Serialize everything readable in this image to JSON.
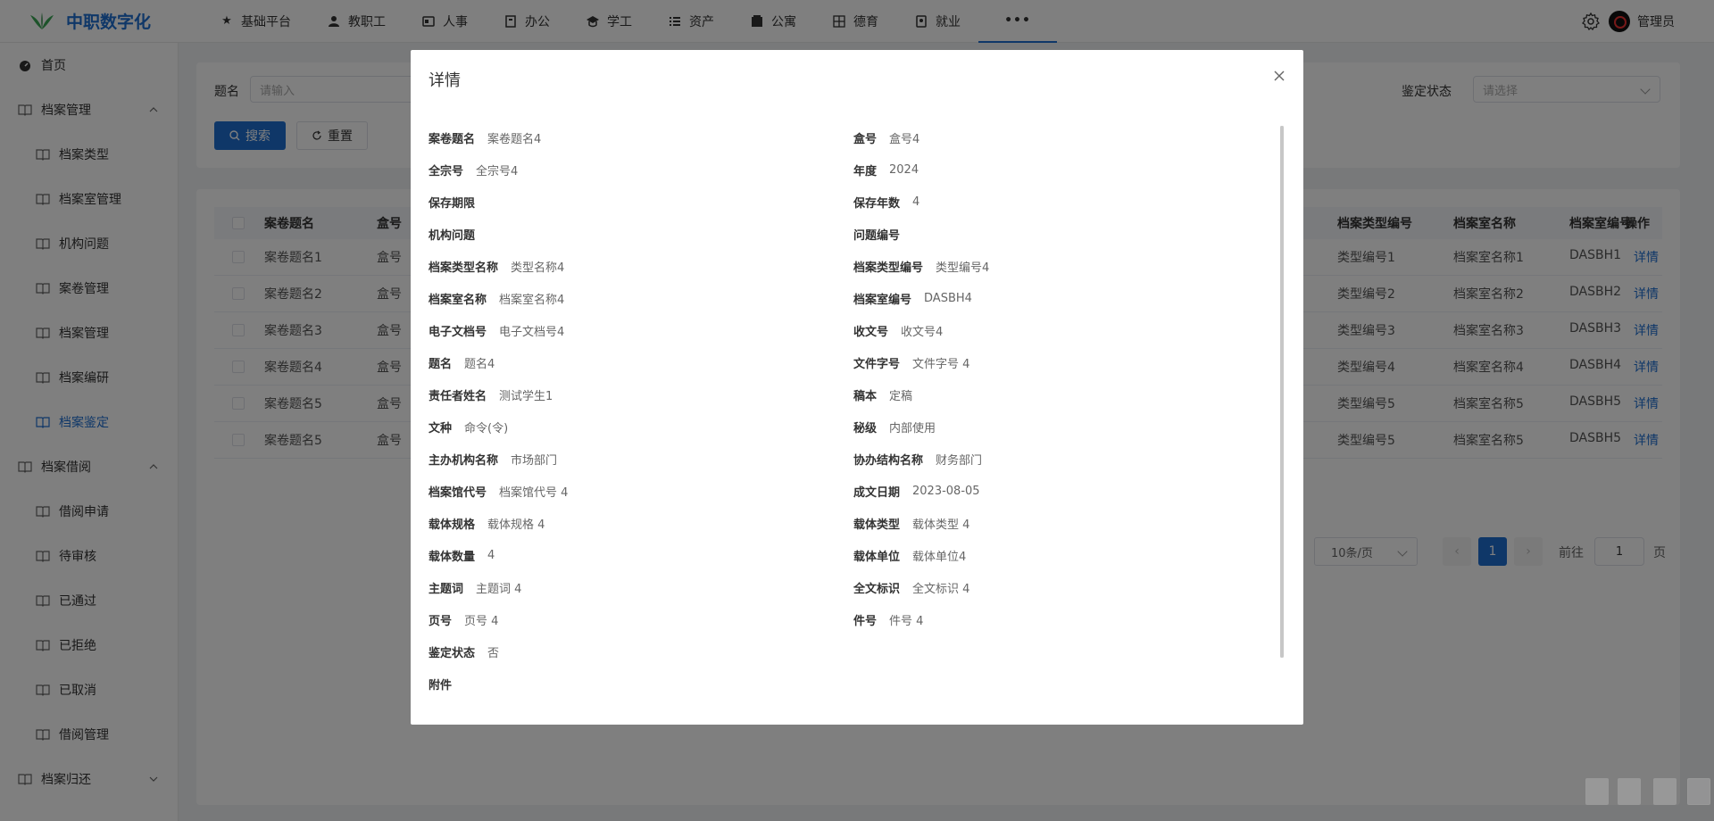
{
  "app": {
    "title": "中职数字化"
  },
  "topnav": {
    "items": [
      {
        "label": "基础平台",
        "icon": "star-icon"
      },
      {
        "label": "教职工",
        "icon": "user-icon"
      },
      {
        "label": "人事",
        "icon": "id-card-icon"
      },
      {
        "label": "办公",
        "icon": "office-icon"
      },
      {
        "label": "学工",
        "icon": "student-icon"
      },
      {
        "label": "资产",
        "icon": "list-icon"
      },
      {
        "label": "公寓",
        "icon": "building-icon"
      },
      {
        "label": "德育",
        "icon": "grid-icon"
      },
      {
        "label": "就业",
        "icon": "briefcase-icon"
      },
      {
        "label": "•••",
        "icon": "more-icon"
      }
    ],
    "user": "管理员"
  },
  "sidebar": {
    "items": [
      {
        "label": "首页",
        "level": 0
      },
      {
        "label": "档案管理",
        "level": 0,
        "expanded": true
      },
      {
        "label": "档案类型",
        "level": 1
      },
      {
        "label": "档案室管理",
        "level": 1
      },
      {
        "label": "机构问题",
        "level": 1
      },
      {
        "label": "案卷管理",
        "level": 1
      },
      {
        "label": "档案管理",
        "level": 1
      },
      {
        "label": "档案编研",
        "level": 1
      },
      {
        "label": "档案鉴定",
        "level": 1,
        "active": true
      },
      {
        "label": "档案借阅",
        "level": 0,
        "expanded": true
      },
      {
        "label": "借阅申请",
        "level": 1
      },
      {
        "label": "待审核",
        "level": 1
      },
      {
        "label": "已通过",
        "level": 1
      },
      {
        "label": "已拒绝",
        "level": 1
      },
      {
        "label": "已取消",
        "level": 1
      },
      {
        "label": "借阅管理",
        "level": 1
      },
      {
        "label": "档案归还",
        "level": 0,
        "expanded": false
      }
    ]
  },
  "filter": {
    "title_label": "题名",
    "title_placeholder": "请输入",
    "status_label": "鉴定状态",
    "status_placeholder": "请选择",
    "search_label": "搜索",
    "reset_label": "重置"
  },
  "table": {
    "headers": [
      "案卷题名",
      "盒号",
      "档案类型编号",
      "档案室名称",
      "档案室编号",
      "操作"
    ],
    "rows": [
      {
        "title": "案卷题名1",
        "box": "盒号",
        "type_code": "类型编号1",
        "room_name": "档案室名称1",
        "room_code": "DASBH1",
        "action": "详情"
      },
      {
        "title": "案卷题名2",
        "box": "盒号",
        "type_code": "类型编号2",
        "room_name": "档案室名称2",
        "room_code": "DASBH2",
        "action": "详情"
      },
      {
        "title": "案卷题名3",
        "box": "盒号",
        "type_code": "类型编号3",
        "room_name": "档案室名称3",
        "room_code": "DASBH3",
        "action": "详情"
      },
      {
        "title": "案卷题名4",
        "box": "盒号",
        "type_code": "类型编号4",
        "room_name": "档案室名称4",
        "room_code": "DASBH4",
        "action": "详情"
      },
      {
        "title": "案卷题名5",
        "box": "盒号",
        "type_code": "类型编号5",
        "room_name": "档案室名称5",
        "room_code": "DASBH5",
        "action": "详情"
      },
      {
        "title": "案卷题名5",
        "box": "盒号",
        "type_code": "类型编号5",
        "room_name": "档案室名称5",
        "room_code": "DASBH5",
        "action": "详情"
      }
    ]
  },
  "pagination": {
    "page_size": "10条/页",
    "current_page": "1",
    "goto_label": "前往",
    "goto_value": "1",
    "page_suffix": "页",
    "prev": "‹",
    "next": "›"
  },
  "modal": {
    "title": "详情",
    "fields_left": [
      {
        "k": "案卷题名",
        "v": "案卷题名4"
      },
      {
        "k": "全宗号",
        "v": "全宗号4"
      },
      {
        "k": "保存期限",
        "v": ""
      },
      {
        "k": "机构问题",
        "v": ""
      },
      {
        "k": "档案类型名称",
        "v": "类型名称4"
      },
      {
        "k": "档案室名称",
        "v": "档案室名称4"
      },
      {
        "k": "电子文档号",
        "v": "电子文档号4"
      },
      {
        "k": "题名",
        "v": "题名4"
      },
      {
        "k": "责任者姓名",
        "v": "测试学生1"
      },
      {
        "k": "文种",
        "v": "命令(令)"
      },
      {
        "k": "主办机构名称",
        "v": "市场部门"
      },
      {
        "k": "档案馆代号",
        "v": "档案馆代号 4"
      },
      {
        "k": "载体规格",
        "v": "载体规格 4"
      },
      {
        "k": "载体数量",
        "v": "4"
      },
      {
        "k": "主题词",
        "v": "主题词 4"
      },
      {
        "k": "页号",
        "v": "页号 4"
      },
      {
        "k": "鉴定状态",
        "v": "否"
      },
      {
        "k": "附件",
        "v": ""
      }
    ],
    "fields_right": [
      {
        "k": "盒号",
        "v": "盒号4"
      },
      {
        "k": "年度",
        "v": "2024"
      },
      {
        "k": "保存年数",
        "v": "4"
      },
      {
        "k": "问题编号",
        "v": ""
      },
      {
        "k": "档案类型编号",
        "v": "类型编号4"
      },
      {
        "k": "档案室编号",
        "v": "DASBH4"
      },
      {
        "k": "收文号",
        "v": "收文号4"
      },
      {
        "k": "文件字号",
        "v": "文件字号 4"
      },
      {
        "k": "稿本",
        "v": "定稿"
      },
      {
        "k": "秘级",
        "v": "内部使用"
      },
      {
        "k": "协办结构名称",
        "v": "财务部门"
      },
      {
        "k": "成文日期",
        "v": "2023-08-05"
      },
      {
        "k": "载体类型",
        "v": "载体类型 4"
      },
      {
        "k": "载体单位",
        "v": "载体单位4"
      },
      {
        "k": "全文标识",
        "v": "全文标识 4"
      },
      {
        "k": "件号",
        "v": "件号 4"
      }
    ]
  }
}
